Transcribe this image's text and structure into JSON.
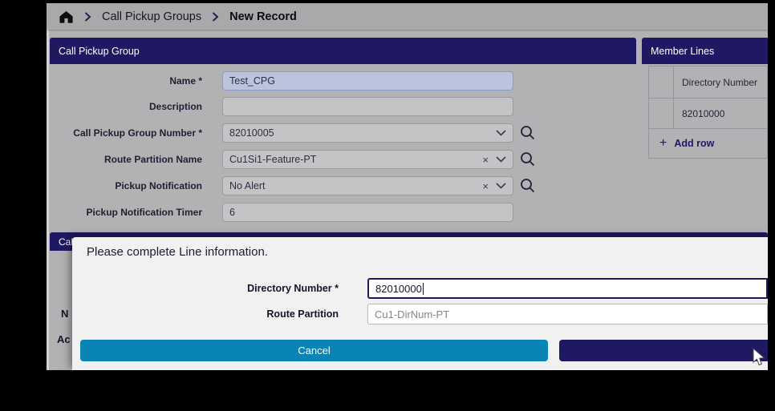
{
  "breadcrumb": {
    "items": [
      {
        "label": "Call Pickup Groups"
      },
      {
        "label": "New Record"
      }
    ]
  },
  "main_panel": {
    "title": "Call Pickup Group",
    "fields": [
      {
        "label": "Name *",
        "value": "Test_CPG",
        "type": "text"
      },
      {
        "label": "Description",
        "value": "",
        "type": "text"
      },
      {
        "label": "Call Pickup Group Number *",
        "value": "82010005",
        "type": "dropdown-search"
      },
      {
        "label": "Route Partition Name",
        "value": "Cu1Si1-Feature-PT",
        "type": "dropdown-clear-search"
      },
      {
        "label": "Pickup Notification",
        "value": "No Alert",
        "type": "dropdown-clear-search"
      },
      {
        "label": "Pickup Notification Timer",
        "value": "6",
        "type": "text"
      }
    ]
  },
  "member_lines": {
    "title": "Member Lines",
    "column_header": "Directory Number",
    "rows": [
      {
        "directory_number": "82010000"
      }
    ],
    "add_icon": "+",
    "add_row_label": "Add row"
  },
  "background_panel": {
    "title_fragment": "Cal",
    "fragment_1": "N",
    "fragment_2": "Ac"
  },
  "modal": {
    "message": "Please complete Line information.",
    "fields": [
      {
        "label": "Directory Number *",
        "value": "82010000"
      },
      {
        "label": "Route Partition",
        "value": "Cu1-DirNum-PT"
      }
    ],
    "buttons": [
      {
        "label": "Cancel"
      },
      {
        "label": ""
      }
    ]
  },
  "icons": {
    "clear": "×",
    "add": "+"
  },
  "colors": {
    "navy": "#1f1963",
    "teal": "#0a84b4",
    "page_gray": "#b2b2b4",
    "modal_bg": "#f1f1f2",
    "name_input_bg": "#bac4dd"
  }
}
